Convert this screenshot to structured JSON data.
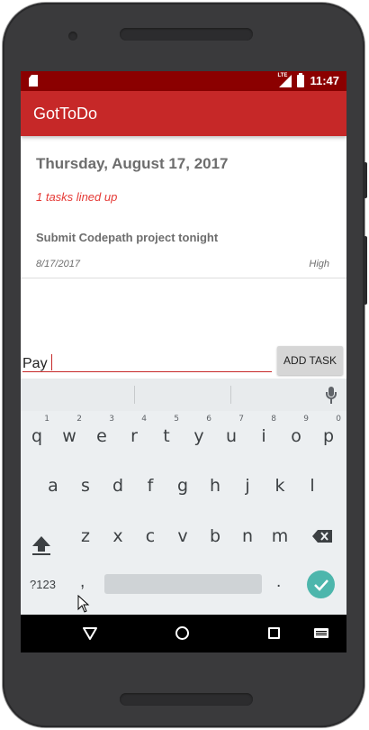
{
  "status_bar": {
    "time": "11:47",
    "network_label": "LTE",
    "icons": [
      "sd-card-icon",
      "lte-signal-icon",
      "battery-charging-icon"
    ]
  },
  "app_bar": {
    "title": "GotToDo"
  },
  "header": {
    "date": "Thursday, August 17, 2017",
    "task_count": "1 tasks lined up"
  },
  "tasks": [
    {
      "name": "Submit Codepath project tonight",
      "date": "8/17/2017",
      "priority": "High"
    }
  ],
  "new_task": {
    "value": "Pay",
    "button_label": "ADD TASK"
  },
  "keyboard": {
    "row1": [
      {
        "key": "q",
        "hint": "1"
      },
      {
        "key": "w",
        "hint": "2"
      },
      {
        "key": "e",
        "hint": "3"
      },
      {
        "key": "r",
        "hint": "4"
      },
      {
        "key": "t",
        "hint": "5"
      },
      {
        "key": "y",
        "hint": "6"
      },
      {
        "key": "u",
        "hint": "7"
      },
      {
        "key": "i",
        "hint": "8"
      },
      {
        "key": "o",
        "hint": "9"
      },
      {
        "key": "p",
        "hint": "0"
      }
    ],
    "row2": [
      "a",
      "s",
      "d",
      "f",
      "g",
      "h",
      "j",
      "k",
      "l"
    ],
    "row3": [
      "z",
      "x",
      "c",
      "v",
      "b",
      "n",
      "m"
    ],
    "symbols_label": "?123",
    "comma": ",",
    "period": "."
  },
  "colors": {
    "status_bar": "#8b0000",
    "app_bar": "#c62828",
    "accent_red": "#e53935",
    "enter_key": "#4db6ac",
    "keyboard_bg": "#eceff1"
  }
}
